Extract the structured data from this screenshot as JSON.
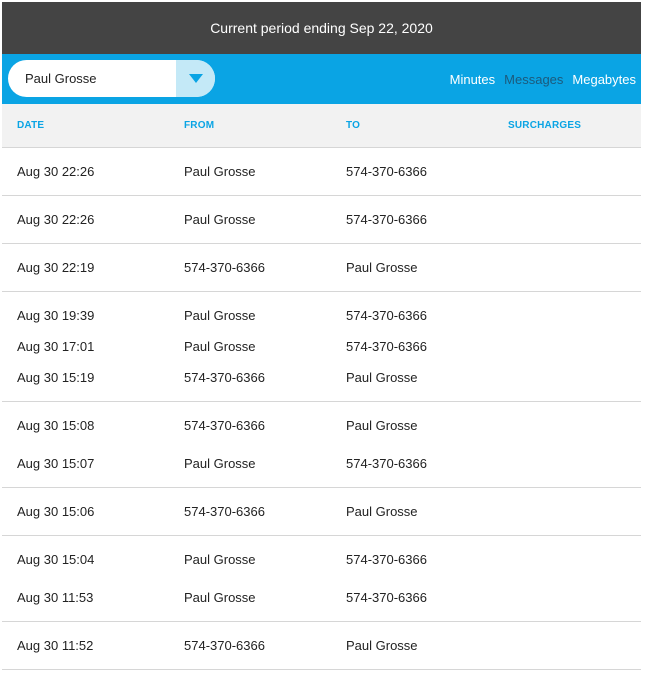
{
  "header": {
    "period_text": "Current period ending Sep 22, 2020"
  },
  "user_select": {
    "value": "Paul Grosse",
    "arrow_icon": "caret-down-icon"
  },
  "view_tabs": [
    {
      "label": "Minutes",
      "active": false
    },
    {
      "label": "Messages",
      "active": true
    },
    {
      "label": "Megabytes",
      "active": false
    }
  ],
  "columns": {
    "date": "DATE",
    "from": "FROM",
    "to": "TO",
    "surcharges": "SURCHARGES"
  },
  "groups": [
    {
      "rows": [
        {
          "date": "Aug 30  22:26",
          "from": "Paul Grosse",
          "to": "574-370-6366",
          "surcharges": ""
        }
      ]
    },
    {
      "rows": [
        {
          "date": "Aug 30  22:26",
          "from": "Paul Grosse",
          "to": "574-370-6366",
          "surcharges": ""
        }
      ]
    },
    {
      "rows": [
        {
          "date": "Aug 30  22:19",
          "from": "574-370-6366",
          "to": "Paul Grosse",
          "surcharges": ""
        }
      ]
    },
    {
      "rows": [
        {
          "date": "Aug 30  19:39",
          "from": "Paul Grosse",
          "to": "574-370-6366",
          "surcharges": ""
        },
        {
          "date": "Aug 30  17:01",
          "from": "Paul Grosse",
          "to": "574-370-6366",
          "surcharges": ""
        },
        {
          "date": "Aug 30  15:19",
          "from": "574-370-6366",
          "to": "Paul Grosse",
          "surcharges": ""
        }
      ]
    },
    {
      "rows": [
        {
          "date": "Aug 30  15:08",
          "from": "574-370-6366",
          "to": "Paul Grosse",
          "surcharges": ""
        },
        {
          "date": "Aug 30  15:07",
          "from": "Paul Grosse",
          "to": "574-370-6366",
          "surcharges": ""
        }
      ]
    },
    {
      "rows": [
        {
          "date": "Aug 30  15:06",
          "from": "574-370-6366",
          "to": "Paul Grosse",
          "surcharges": ""
        }
      ]
    },
    {
      "rows": [
        {
          "date": "Aug 30  15:04",
          "from": "Paul Grosse",
          "to": "574-370-6366",
          "surcharges": ""
        },
        {
          "date": "Aug 30  11:53",
          "from": "Paul Grosse",
          "to": "574-370-6366",
          "surcharges": ""
        }
      ]
    },
    {
      "rows": [
        {
          "date": "Aug 30  11:52",
          "from": "574-370-6366",
          "to": "Paul Grosse",
          "surcharges": ""
        }
      ]
    }
  ],
  "colors": {
    "header_bg": "#444444",
    "accent": "#0aa4e4",
    "active_tab": "#1c5a7c",
    "column_header_bg": "#f2f2f2"
  }
}
